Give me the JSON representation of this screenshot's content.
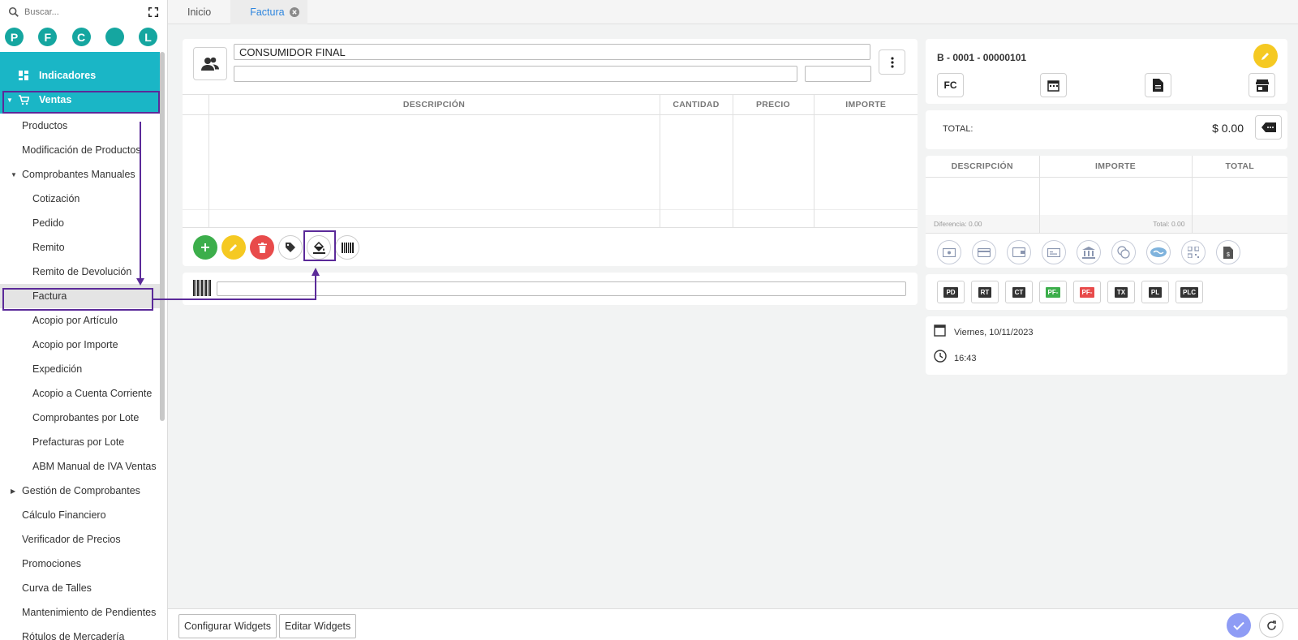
{
  "sidebar": {
    "search_placeholder": "Buscar...",
    "avatars": [
      "P",
      "F",
      "C",
      "",
      "L"
    ],
    "items": [
      {
        "label": "Indicadores"
      },
      {
        "label": "Ventas"
      },
      {
        "label": "Productos"
      },
      {
        "label": "Modificación de Productos"
      },
      {
        "label": "Comprobantes Manuales"
      },
      {
        "label": "Cotización"
      },
      {
        "label": "Pedido"
      },
      {
        "label": "Remito"
      },
      {
        "label": "Remito de Devolución"
      },
      {
        "label": "Factura"
      },
      {
        "label": "Acopio por Artículo"
      },
      {
        "label": "Acopio por Importe"
      },
      {
        "label": "Expedición"
      },
      {
        "label": "Acopio a Cuenta Corriente"
      },
      {
        "label": "Comprobantes por Lote"
      },
      {
        "label": "Prefacturas por Lote"
      },
      {
        "label": "ABM Manual de IVA Ventas"
      },
      {
        "label": "Gestión de Comprobantes"
      },
      {
        "label": "Cálculo Financiero"
      },
      {
        "label": "Verificador de Precios"
      },
      {
        "label": "Promociones"
      },
      {
        "label": "Curva de Talles"
      },
      {
        "label": "Mantenimiento de Pendientes"
      },
      {
        "label": "Rótulos de Mercadería"
      }
    ]
  },
  "tabs": [
    {
      "label": "Inicio"
    },
    {
      "label": "Factura"
    }
  ],
  "customer": {
    "name": "CONSUMIDOR FINAL",
    "address": "",
    "doc": ""
  },
  "items_table": {
    "headers": [
      "",
      "DESCRIPCIÓN",
      "CANTIDAD",
      "PRECIO",
      "IMPORTE"
    ]
  },
  "invoice": {
    "number": "B - 0001 - 00000101",
    "type_label": "FC",
    "total_label": "TOTAL:",
    "total_value": "$ 0.00"
  },
  "payments_table": {
    "headers": [
      "DESCRIPCIÓN",
      "IMPORTE",
      "TOTAL"
    ],
    "diferencia": "Diferencia: 0.00",
    "total_footer": "Total: 0.00"
  },
  "doc_buttons": [
    "PD",
    "RT",
    "CT",
    "PF-",
    "PF-",
    "TX",
    "PL",
    "PLC"
  ],
  "datetime": {
    "date": "Viernes, 10/11/2023",
    "time": "16:43"
  },
  "bottom": {
    "configure": "Configurar Widgets",
    "edit": "Editar Widgets"
  },
  "colors": {
    "cyan": "#1ab6c6",
    "teal_avatar": "#15a6a0",
    "add_green": "#3cae4b",
    "edit_yellow": "#f5c922",
    "delete_red": "#e84b4b",
    "highlight_purple": "#5b2a99",
    "tab_active": "#2e86de"
  }
}
